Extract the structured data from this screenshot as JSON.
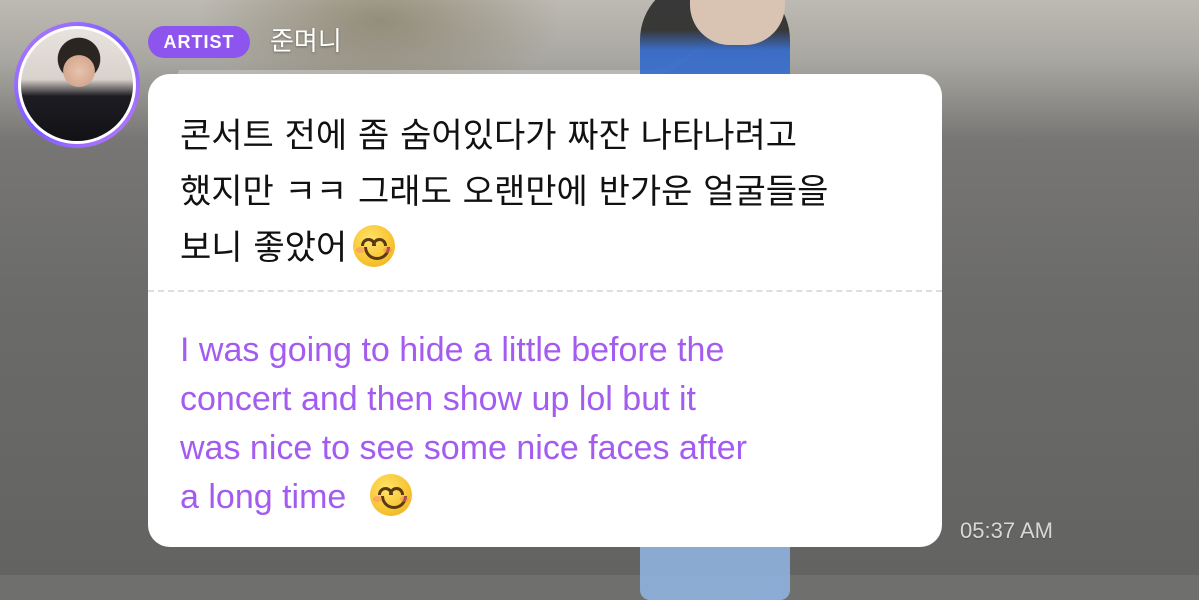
{
  "header": {
    "badge": "ARTIST",
    "username": "준며니"
  },
  "message": {
    "korean_lines": [
      "콘서트 전에 좀 숨어있다가 짜잔 나타나려고",
      "했지만 ㅋㅋ 그래도 오랜만에 반가운 얼굴들을",
      "보니 좋았어"
    ],
    "translation_lines": [
      "I was going to hide a little before the",
      "concert and then show up lol but it",
      "was nice to see some nice faces after",
      "a long time"
    ],
    "emoji": "smiling-face-emoji",
    "timestamp": "05:37 AM"
  },
  "colors": {
    "badge_bg": "#8e55ee",
    "translation_text": "#a45cf0",
    "avatar_ring": "#9b6bff"
  }
}
